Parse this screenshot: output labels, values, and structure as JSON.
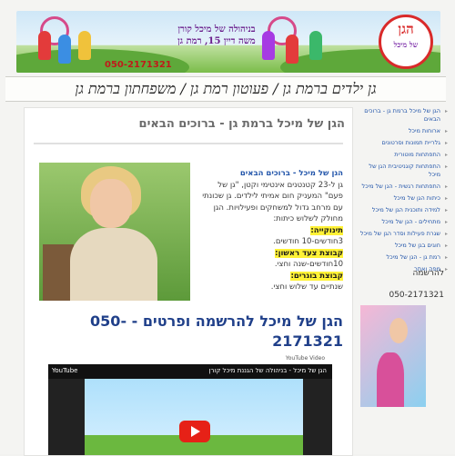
{
  "header": {
    "sign_line1": "בניהולה של מיכל קורן",
    "sign_line2": "משה דיין 15, רמת גן",
    "phone": "050-2171321",
    "logo_main": "הגן",
    "logo_sub": "של מיכל"
  },
  "titlebar": {
    "text": "גן ילדים ברמת גן / פעוטון רמת גן / משפחתון ברמת גן"
  },
  "main": {
    "post_title": "הגן של מיכל ברמת גן - ברוכים הבאים",
    "intro_link": "הגן של מיכל - ברוכים הבאים",
    "body": "גן ל-23 קטנטנים אינטימי וקטן, \"גן של פעם\" המעניק חום אמיתי לילדים. גן שכונתי עם מרחב גדול למשחקים ופעילויות. הגן מחולק לשלוש כיתות:",
    "group1_label": "תינוקייה:",
    "group1_text": "3חודשים-10 חודשים.",
    "group2_label": "קבוצת צעד ראשון:",
    "group2_text": "10חודשים-שנה וחצי.",
    "group3_label": "קבוצת בוגרים:",
    "group3_text": "שנתיים עד שלוש וחצי.",
    "big_heading": "הגן של מיכל להרשמה ופרטים - -050 2171321",
    "video_label": "YouTube Video",
    "video_brand": "YouTube",
    "video_title": "הגן של מיכל - בניהולה של הגננת מיכל קורן"
  },
  "sidebar": {
    "items": [
      "הגן של מיכל ברמת גן - ברוכים הבאים",
      "ארוחות מיכל",
      "גלריית תמונות וסרטונים",
      "התפתחות מוטורית",
      "התפתחות קוגניטיבית הגן של מיכל",
      "התפתחות רגשית - הגן של מיכל",
      "כיתות הגן של מיכל",
      "למידה ותוכנית הגן של מיכל",
      "מתחילים - הגן של מיכל",
      "שגרת פעילות וסדר הגן של מיכל",
      "חוגים בגן של מיכל",
      "רמת גן - הגן של מיכל",
      "מפה ואתר"
    ],
    "register_title": "להרשמה",
    "register_phone": "050-2171321"
  },
  "colors": {
    "link": "#2255aa",
    "heading": "#20408a",
    "highlight": "#fff236",
    "phone_red": "#c01a1a"
  }
}
